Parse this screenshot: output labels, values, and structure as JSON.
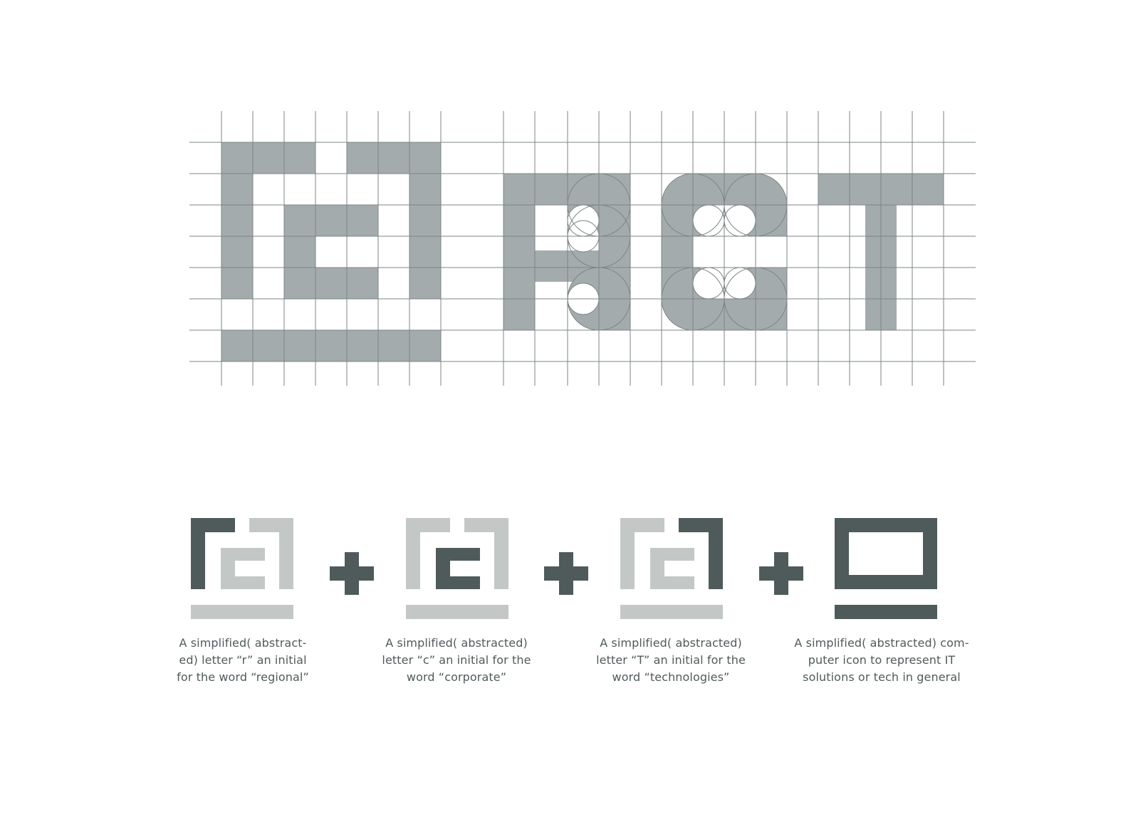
{
  "colors": {
    "grid_line": "#7d8586",
    "grid_fill": "#a4abac",
    "dark": "#4f5a5b",
    "light": "#c3c8c6",
    "caption_text": "#4f5a5b",
    "background": "#ffffff"
  },
  "symbols": [
    {
      "name": "letter-r-mark",
      "highlight": "r"
    },
    {
      "name": "letter-c-mark",
      "highlight": "c"
    },
    {
      "name": "letter-t-mark",
      "highlight": "t"
    },
    {
      "name": "computer-icon-mark",
      "highlight": "computer"
    }
  ],
  "operators": [
    "plus-icon",
    "plus-icon",
    "plus-icon"
  ],
  "captions": [
    {
      "line1": "A simplified( abstract-",
      "line2": "ed) letter “r” an initial",
      "line3": "for the word “regional”"
    },
    {
      "line1": "A simplified( abstracted)",
      "line2": "letter “c” an initial for the",
      "line3": "word “corporate”"
    },
    {
      "line1": "A simplified( abstracted)",
      "line2": "letter “T” an initial for the",
      "line3": "word “technologies”"
    },
    {
      "line1": "A simplified( abstracted) com-",
      "line2": "puter icon to represent IT",
      "line3": "solutions or tech in general"
    }
  ]
}
